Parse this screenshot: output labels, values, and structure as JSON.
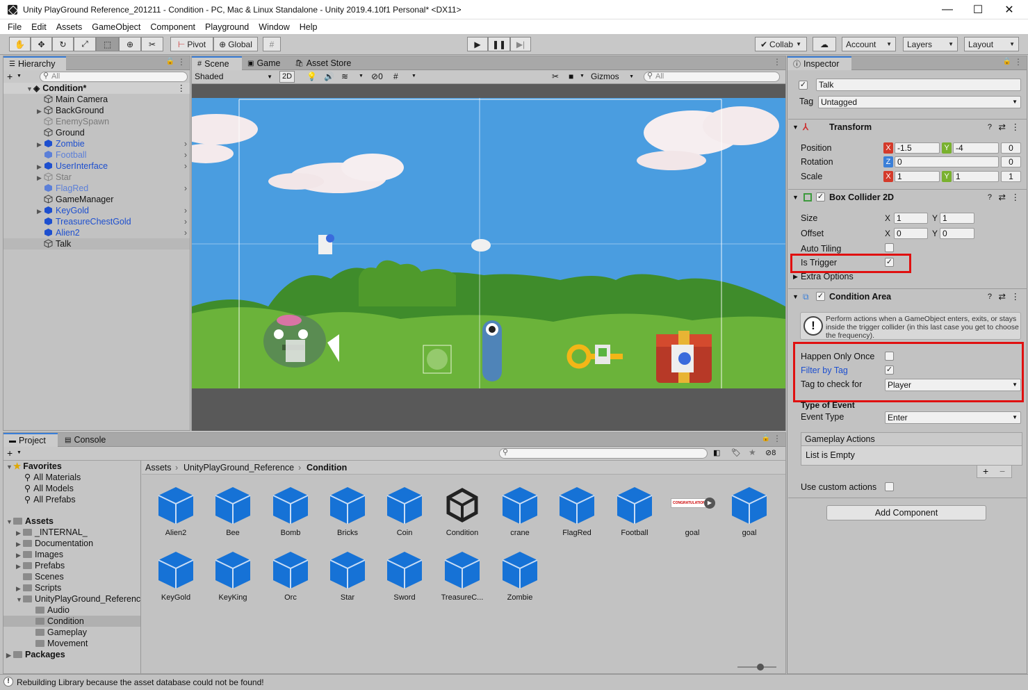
{
  "window": {
    "title": "Unity PlayGround Reference_201211 - Condition - PC, Mac & Linux Standalone - Unity 2019.4.10f1 Personal* <DX11>",
    "minimize": "—",
    "maximize": "☐",
    "close": "✕"
  },
  "menu": [
    "File",
    "Edit",
    "Assets",
    "GameObject",
    "Component",
    "Playground",
    "Window",
    "Help"
  ],
  "toolbar": {
    "pivot": "Pivot",
    "global": "Global",
    "collab": "Collab",
    "account": "Account",
    "layers": "Layers",
    "layout": "Layout"
  },
  "hierarchy": {
    "tab": "Hierarchy",
    "search_placeholder": "All",
    "scene": "Condition*",
    "items": [
      {
        "label": "Main Camera",
        "color": "#111111"
      },
      {
        "label": "BackGround",
        "color": "#111111"
      },
      {
        "label": "EnemySpawn",
        "color": "#7a7a7a"
      },
      {
        "label": "Ground",
        "color": "#111111"
      },
      {
        "label": "Zombie",
        "color": "#1d4fcf"
      },
      {
        "label": "Football",
        "color": "#5b7fd8"
      },
      {
        "label": "UserInterface",
        "color": "#1d4fcf"
      },
      {
        "label": "Star",
        "color": "#7a7a7a"
      },
      {
        "label": "FlagRed",
        "color": "#5b7fd8"
      },
      {
        "label": "GameManager",
        "color": "#111111"
      },
      {
        "label": "KeyGold",
        "color": "#1d4fcf"
      },
      {
        "label": "TreasureChestGold",
        "color": "#1d4fcf"
      },
      {
        "label": "Alien2",
        "color": "#1d4fcf"
      },
      {
        "label": "Talk",
        "color": "#111111"
      }
    ]
  },
  "scene": {
    "tabs": [
      "Scene",
      "Game",
      "Asset Store"
    ],
    "shading": "Shaded",
    "mode2d": "2D",
    "hidden_count": "0",
    "gizmos": "Gizmos",
    "search_placeholder": "All"
  },
  "inspector": {
    "tab": "Inspector",
    "object_name": "Talk",
    "tag_label": "Tag",
    "tag_value": "Untagged",
    "transform": {
      "title": "Transform",
      "position_label": "Position",
      "pos_x": "-1.5",
      "pos_y": "-4",
      "pos_z": "0",
      "rotation_label": "Rotation",
      "rot_z": "0",
      "rot_extra": "0",
      "scale_label": "Scale",
      "scale_x": "1",
      "scale_y": "1",
      "scale_z": "1"
    },
    "box_collider": {
      "title": "Box Collider 2D",
      "size_label": "Size",
      "size_x": "1",
      "size_y": "1",
      "offset_label": "Offset",
      "offset_x": "0",
      "offset_y": "0",
      "auto_tiling": "Auto Tiling",
      "is_trigger": "Is Trigger",
      "extra_options": "Extra Options"
    },
    "condition_area": {
      "title": "Condition Area",
      "help": "Perform actions when a GameObject enters, exits, or stays inside the trigger collider (in this last case you get to choose the frequency).",
      "happen_once": "Happen Only Once",
      "filter_by_tag": "Filter by Tag",
      "tag_to_check": "Tag to check for",
      "tag_value": "Player",
      "type_of_event": "Type of Event",
      "event_type": "Event Type",
      "event_value": "Enter",
      "gameplay_actions": "Gameplay Actions",
      "list_empty": "List is Empty",
      "plus": "+",
      "minus": "−",
      "use_custom": "Use custom actions"
    },
    "add_component": "Add Component"
  },
  "project": {
    "tabs": [
      "Project",
      "Console"
    ],
    "breadcrumb": [
      "Assets",
      "UnityPlayGround_Reference",
      "Condition"
    ],
    "hidden_count": "8",
    "favorites": {
      "label": "Favorites",
      "items": [
        "All Materials",
        "All Models",
        "All Prefabs"
      ]
    },
    "assets_root": "Assets",
    "folders": [
      "_INTERNAL_",
      "Documentation",
      "Images",
      "Prefabs",
      "Scenes",
      "Scripts",
      "UnityPlayGround_Referenc"
    ],
    "subfolders": [
      "Audio",
      "Condition",
      "Gameplay",
      "Movement"
    ],
    "packages": "Packages",
    "assets": [
      "Alien2",
      "Bee",
      "Bomb",
      "Bricks",
      "Coin",
      "Condition",
      "crane",
      "FlagRed",
      "Football",
      "goal",
      "goal",
      "KeyGold",
      "KeyKing",
      "Orc",
      "Star",
      "Sword",
      "TreasureC...",
      "Zombie"
    ],
    "goal_banner": "CONGRATULATIONS"
  },
  "status": "Rebuilding Library because the asset database could not be found!",
  "colors": {
    "accent": "#3a7fd8",
    "highlight": "#e01010",
    "prefab_blue": "#1672d6",
    "sky": "#4a9de0",
    "grass": "#5c9e2e"
  }
}
